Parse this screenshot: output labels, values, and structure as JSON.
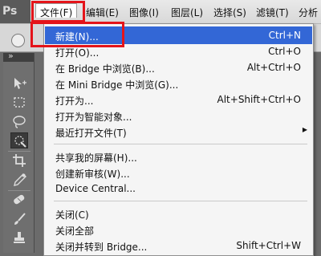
{
  "app": {
    "logo_text": "Ps"
  },
  "menubar": {
    "items": [
      {
        "label": "文件(F)"
      },
      {
        "label": "编辑(E)"
      },
      {
        "label": "图像(I)"
      },
      {
        "label": "图层(L)"
      },
      {
        "label": "选择(S)"
      },
      {
        "label": "滤镜(T)"
      },
      {
        "label": "分析"
      }
    ],
    "active_index": 0
  },
  "file_menu": {
    "items": [
      {
        "label": "新建(N)...",
        "shortcut": "Ctrl+N",
        "highlighted": true
      },
      {
        "label": "打开(O)...",
        "shortcut": "Ctrl+O"
      },
      {
        "label": "在 Bridge 中浏览(B)...",
        "shortcut": "Alt+Ctrl+O"
      },
      {
        "label": "在 Mini Bridge 中浏览(G)...",
        "shortcut": ""
      },
      {
        "label": "打开为...",
        "shortcut": "Alt+Shift+Ctrl+O"
      },
      {
        "label": "打开为智能对象...",
        "shortcut": ""
      },
      {
        "label": "最近打开文件(T)",
        "shortcut": "",
        "submenu": true
      },
      {
        "label": "共享我的屏幕(H)...",
        "shortcut": ""
      },
      {
        "label": "创建新审核(W)...",
        "shortcut": ""
      },
      {
        "label": "Device Central...",
        "shortcut": ""
      },
      {
        "label": "关闭(C)",
        "shortcut": ""
      },
      {
        "label": "关闭全部",
        "shortcut": ""
      },
      {
        "label": "关闭并转到 Bridge...",
        "shortcut": "Shift+Ctrl+W"
      }
    ],
    "submenu_arrow": "▶"
  },
  "tools": [
    "move-tool-icon",
    "marquee-tool-icon",
    "lasso-tool-icon",
    "quick-selection-tool-icon",
    "crop-tool-icon",
    "eyedropper-tool-icon",
    "healing-brush-tool-icon",
    "brush-tool-icon",
    "clone-stamp-tool-icon"
  ],
  "colors": {
    "highlight": "#3367d6",
    "annotation_red": "#e4141a"
  }
}
